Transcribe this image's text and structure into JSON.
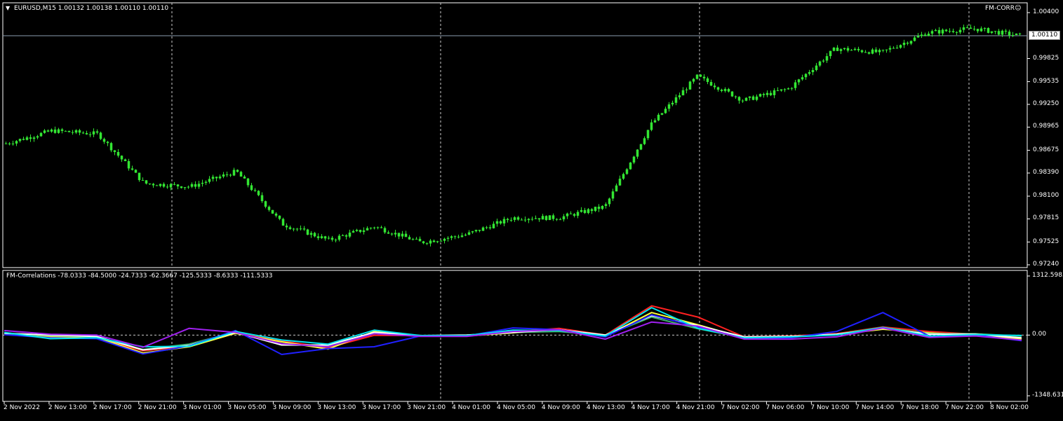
{
  "main": {
    "symbol_title": "EURUSD,M15  1.00132 1.00138 1.00110 1.00110",
    "indicator_badge": "FM-CORR☺",
    "current_price": "1.00110",
    "price_ticks": [
      "1.00400",
      "0.99825",
      "0.99535",
      "0.99250",
      "0.98965",
      "0.98675",
      "0.98390",
      "0.98100",
      "0.97815",
      "0.97525",
      "0.97240"
    ]
  },
  "sub": {
    "title": "FM-Correlations -78.0333 -84.5000 -24.7333 -62.3667 -125.5333 -8.6333 -111.5333",
    "ticks": [
      "1312.5983",
      "0.00",
      "-1348.6311"
    ]
  },
  "time_axis": [
    "2 Nov 2022",
    "2 Nov 13:00",
    "2 Nov 17:00",
    "2 Nov 21:00",
    "3 Nov 01:00",
    "3 Nov 05:00",
    "3 Nov 09:00",
    "3 Nov 13:00",
    "3 Nov 17:00",
    "3 Nov 21:00",
    "4 Nov 01:00",
    "4 Nov 05:00",
    "4 Nov 09:00",
    "4 Nov 13:00",
    "4 Nov 17:00",
    "4 Nov 21:00",
    "7 Nov 02:00",
    "7 Nov 06:00",
    "7 Nov 10:00",
    "7 Nov 14:00",
    "7 Nov 18:00",
    "7 Nov 22:00",
    "8 Nov 02:00"
  ],
  "chart_data": [
    {
      "type": "line",
      "title": "EURUSD,M15",
      "candle_color": "#33e633",
      "ylim": [
        0.9724,
        1.004
      ],
      "x": [
        "2 Nov 2022",
        "2 Nov 13:00",
        "2 Nov 17:00",
        "2 Nov 21:00",
        "3 Nov 01:00",
        "3 Nov 05:00",
        "3 Nov 09:00",
        "3 Nov 13:00",
        "3 Nov 17:00",
        "3 Nov 21:00",
        "4 Nov 01:00",
        "4 Nov 05:00",
        "4 Nov 09:00",
        "4 Nov 13:00",
        "4 Nov 17:00",
        "4 Nov 21:00",
        "7 Nov 02:00",
        "7 Nov 06:00",
        "7 Nov 10:00",
        "7 Nov 14:00",
        "7 Nov 18:00",
        "7 Nov 22:00",
        "8 Nov 02:00"
      ],
      "series": [
        {
          "values": [
            0.9876,
            0.9892,
            0.9888,
            0.9826,
            0.9822,
            0.9841,
            0.9775,
            0.9755,
            0.9772,
            0.9752,
            0.9762,
            0.9783,
            0.9783,
            0.9797,
            0.99,
            0.996,
            0.993,
            0.9945,
            0.9995,
            0.999,
            1.0015,
            1.002,
            1.0011
          ]
        }
      ]
    },
    {
      "type": "line",
      "title": "FM-Correlations",
      "ylim": [
        -1348.6311,
        1312.5983
      ],
      "x": [
        "2 Nov 2022",
        "2 Nov 13:00",
        "2 Nov 17:00",
        "2 Nov 21:00",
        "3 Nov 01:00",
        "3 Nov 05:00",
        "3 Nov 09:00",
        "3 Nov 13:00",
        "3 Nov 17:00",
        "3 Nov 21:00",
        "4 Nov 01:00",
        "4 Nov 05:00",
        "4 Nov 09:00",
        "4 Nov 13:00",
        "4 Nov 17:00",
        "4 Nov 21:00",
        "7 Nov 02:00",
        "7 Nov 06:00",
        "7 Nov 10:00",
        "7 Nov 14:00",
        "7 Nov 18:00",
        "7 Nov 22:00",
        "8 Nov 02:00"
      ],
      "series": [
        {
          "color": "#ff2020",
          "values": [
            50,
            -30,
            -60,
            -350,
            -250,
            50,
            -130,
            -280,
            -5,
            -10,
            -10,
            80,
            150,
            0,
            650,
            400,
            -40,
            -20,
            30,
            180,
            80,
            20,
            -78
          ]
        },
        {
          "color": "#ffff40",
          "values": [
            30,
            -40,
            -50,
            -400,
            -260,
            40,
            -150,
            -310,
            80,
            -20,
            -20,
            50,
            120,
            -20,
            500,
            230,
            -60,
            -30,
            10,
            130,
            50,
            -10,
            -84
          ]
        },
        {
          "color": "#3cb371",
          "values": [
            20,
            -10,
            -40,
            -320,
            -200,
            70,
            -220,
            -230,
            40,
            -20,
            -10,
            60,
            80,
            -10,
            400,
            140,
            -60,
            -40,
            20,
            170,
            30,
            30,
            -25
          ]
        },
        {
          "color": "#ffffff",
          "values": [
            40,
            0,
            -30,
            -330,
            -230,
            60,
            -220,
            -220,
            60,
            -10,
            0,
            60,
            120,
            0,
            430,
            210,
            -40,
            -30,
            20,
            150,
            20,
            20,
            -62
          ]
        },
        {
          "color": "#2020ff",
          "values": [
            10,
            -60,
            -80,
            -420,
            -240,
            100,
            -430,
            -300,
            -260,
            -20,
            -20,
            160,
            120,
            -40,
            450,
            180,
            -70,
            -60,
            80,
            500,
            -20,
            0,
            -126
          ]
        },
        {
          "color": "#00e5ee",
          "values": [
            60,
            -80,
            -60,
            -260,
            -250,
            80,
            -110,
            -200,
            110,
            -10,
            -10,
            110,
            100,
            -20,
            610,
            150,
            -60,
            -40,
            0,
            170,
            -20,
            10,
            -9
          ]
        },
        {
          "color": "#a020f0",
          "values": [
            100,
            20,
            0,
            -270,
            150,
            60,
            -190,
            -260,
            30,
            -30,
            -30,
            80,
            120,
            -90,
            290,
            200,
            -90,
            -90,
            -40,
            160,
            -50,
            -20,
            -112
          ]
        }
      ]
    }
  ]
}
